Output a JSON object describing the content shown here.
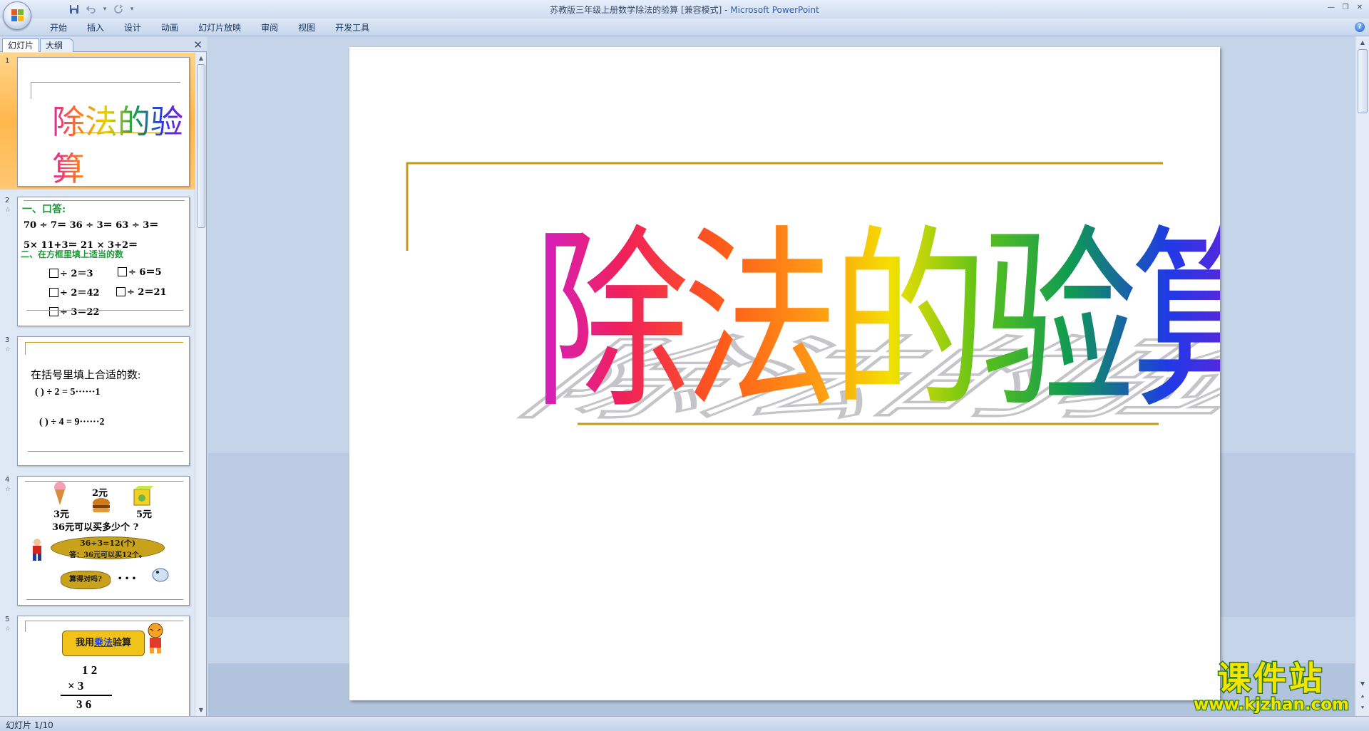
{
  "window": {
    "title": "苏教版三年级上册数学除法的验算 [兼容模式]",
    "app_name": "Microsoft PowerPoint",
    "separator": " - "
  },
  "qat": {
    "save_icon": "save-icon",
    "undo_icon": "undo-icon",
    "redo_icon": "redo-icon",
    "customize_icon": "dropdown-icon"
  },
  "ribbon": {
    "tabs": [
      "开始",
      "插入",
      "设计",
      "动画",
      "幻灯片放映",
      "审阅",
      "视图",
      "开发工具"
    ]
  },
  "pane": {
    "tab_slides": "幻灯片",
    "tab_outline": "大纲",
    "close_glyph": "✕"
  },
  "thumbnails": [
    {
      "num": "1",
      "title": "除法的验算"
    },
    {
      "num": "2",
      "h1": "一、口答:",
      "row1": "70 ÷ 7＝     36  ÷ 3＝     63 ÷ 3＝",
      "row2": "5× 11+3＝           21 × 3+2＝",
      "h2": "二、在方框里填上适当的数",
      "f1": "÷ 2＝3",
      "f2": "÷ 6＝5",
      "f3": "÷ 2＝42",
      "f4": "÷ 2＝21",
      "f5": "÷ 3＝22"
    },
    {
      "num": "3",
      "l1": "在括号里填上合适的数:",
      "l2": "(      )  ÷ 2  =  5······1",
      "l3": "(      )  ÷ 4  =  9······2"
    },
    {
      "num": "4",
      "p1": "3元",
      "p2": "2元",
      "p3": "5元",
      "q": "36元可以买多少个",
      "qmark": "?",
      "a1": "36÷3=12(个)",
      "a2": "答：36元可以买12个。",
      "b": "算得对吗?"
    },
    {
      "num": "5",
      "l1a": "我用",
      "l1b": "乘法",
      "l1c": "验算",
      "r1": "1  2",
      "r2": "×    3",
      "r3": "3  6"
    }
  ],
  "slide": {
    "title": "除法的验算"
  },
  "status": {
    "slide_indicator": "幻灯片 1/10"
  },
  "watermark": {
    "cn": "课件站",
    "url": "www.kjzhan.com"
  },
  "colors": {
    "accent_line": "#c49a1a",
    "selected_thumb": "#ffb74d"
  }
}
